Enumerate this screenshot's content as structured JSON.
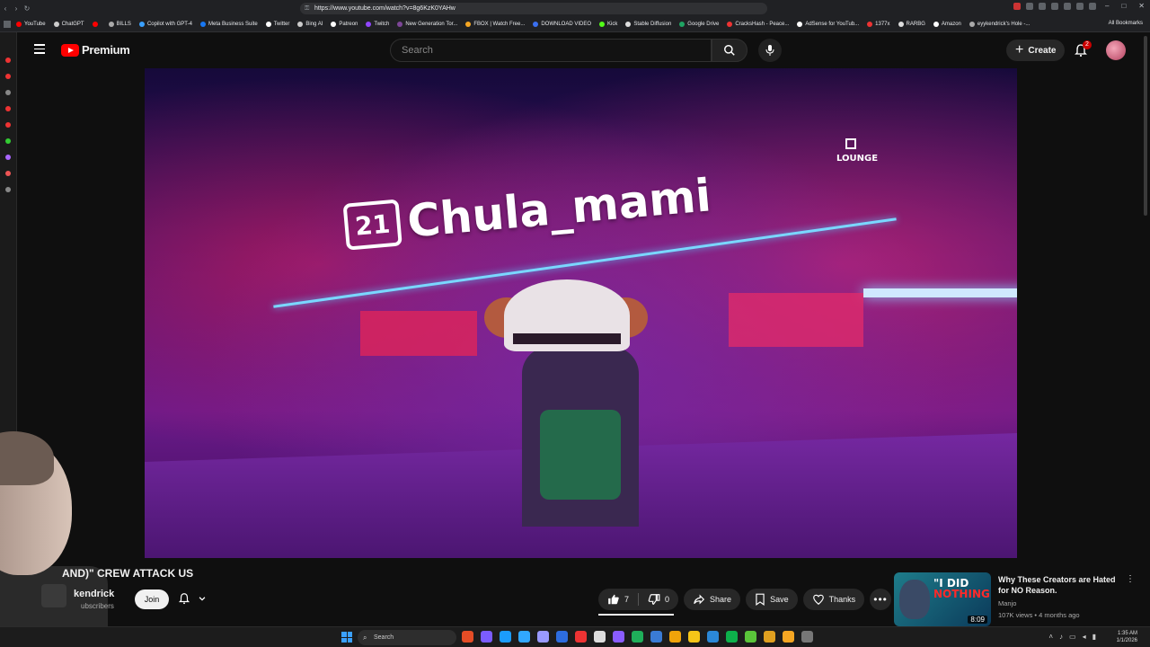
{
  "browser": {
    "url": "https://www.youtube.com/watch?v=8g6KzK0YAHw",
    "bookmarks": [
      "YouTube",
      "ChatGPT",
      "BILLS",
      "Copilot with GPT-4",
      "Meta Business Suite",
      "Twitter",
      "Bing AI",
      "Patreon",
      "Twitch",
      "New Generation Tor...",
      "FBOX | Watch Free...",
      "DOWNLOAD VIDEO",
      "Kick",
      "Stable Diffusion",
      "Google Drive",
      "CracksHash - Peace...",
      "AdSense for YouTub...",
      "1377x",
      "RARBG",
      "Amazon",
      "eyykendrick's Hole -..."
    ],
    "all_bookmarks": "All Bookmarks"
  },
  "header": {
    "brand": "Premium",
    "search_placeholder": "Search",
    "create_label": "Create",
    "notification_count": "2"
  },
  "video": {
    "overlay_number": "21",
    "overlay_name": "Chula_mami",
    "lounge_sign": "LOUNGE",
    "title": "AND)\" CREW ATTACK US",
    "channel": "kendrick",
    "subscribers": "ubscribers",
    "join_label": "Join",
    "likes": "7",
    "dislikes": "0",
    "share_label": "Share",
    "save_label": "Save",
    "thanks_label": "Thanks",
    "more_label": "•••"
  },
  "related": {
    "thumb_text_1": "\"I DID",
    "thumb_text_2": "NOTHING\"",
    "duration": "8:09",
    "title": "Why These Creators are Hated for NO Reason.",
    "channel": "Manjo",
    "meta": "107K views • 4 months ago"
  },
  "taskbar": {
    "search_label": "Search",
    "time": "1:35 AM",
    "date": "1/1/2026"
  },
  "colors": {
    "brand_red": "#ff0000",
    "background": "#0f0f0f",
    "pill": "#272727"
  }
}
